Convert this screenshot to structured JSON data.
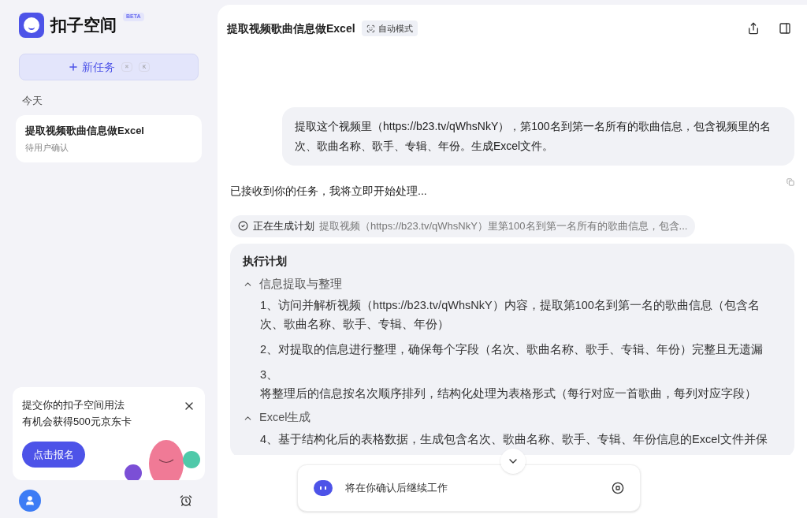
{
  "sidebar": {
    "logo_text": "扣子空间",
    "badge": "BETA",
    "new_task": {
      "label": "新任务",
      "keys": [
        "⌘",
        "K"
      ]
    },
    "section": "今天",
    "tasks": [
      {
        "title": "提取视频歌曲信息做Excel",
        "status": "待用户确认",
        "selected": true
      }
    ],
    "promo": {
      "lines": [
        "提交你的扣子空间用法",
        "有机会获得500元京东卡"
      ],
      "button": "点击报名"
    }
  },
  "header": {
    "title": "提取视频歌曲信息做Excel",
    "mode": "自动模式"
  },
  "user_message": "提取这个视频里（https://b23.tv/qWhsNkY），第100名到第一名所有的歌曲信息，包含视频里的名次、歌曲名称、歌手、专辑、年份。生成Excel文件。",
  "reply": "已接收到你的任务，我将立即开始处理...",
  "plan_status": {
    "label": "正在生成计划",
    "detail": "提取视频（https://b23.tv/qWhsNkY）里第100名到第一名所有的歌曲信息，包含..."
  },
  "plan": {
    "title": "执行计划",
    "sections": [
      {
        "title": "信息提取与整理",
        "expanded": true,
        "steps": [
          {
            "kind": "inline",
            "number": "1、",
            "text": "访问并解析视频（https://b23.tv/qWhsNkY）内容，提取第100名到第一名的歌曲信息（包含名次、歌曲名称、歌手、专辑、年份）"
          },
          {
            "kind": "inline",
            "number": "2、",
            "text": "对提取的信息进行整理，确保每个字段（名次、歌曲名称、歌手、专辑、年份）完整且无遗漏"
          },
          {
            "kind": "break",
            "number": "3、",
            "text": "将整理后的信息按名次顺序排列，结构化处理为表格形式（每行对应一首歌曲，每列对应字段）"
          }
        ]
      },
      {
        "title": "Excel生成",
        "expanded": true,
        "steps": [
          {
            "kind": "inline",
            "number": "4、",
            "text": "基于结构化后的表格数据，生成包含名次、歌曲名称、歌手、专辑、年份信息的Excel文件并保"
          }
        ]
      }
    ]
  },
  "status_bar": {
    "text": "将在你确认后继续工作"
  }
}
